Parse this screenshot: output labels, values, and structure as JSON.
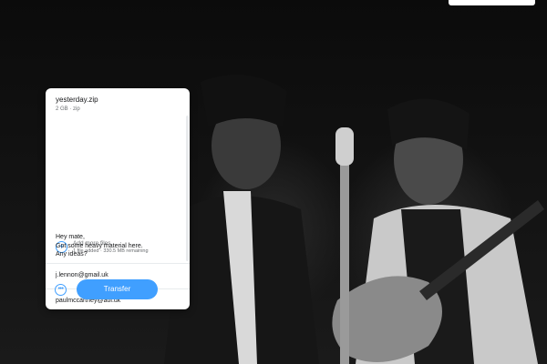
{
  "file": {
    "name": "yesterday.zip",
    "meta": "2 GB · zip"
  },
  "add_files": {
    "label": "Add more files",
    "status": "1 file added · 330.5 MB remaining",
    "icon": "plus-circle-icon"
  },
  "fields": {
    "email_to": "j.lennon@gmail.uk",
    "email_from": "paulmccartney@aol.uk",
    "message": [
      "Hey mate,",
      "Got some heavy material here.",
      "Any ideas?"
    ]
  },
  "actions": {
    "more_icon": "ellipsis-icon",
    "transfer_label": "Transfer"
  },
  "colors": {
    "accent": "#409fff",
    "panel_bg": "#ffffff",
    "text": "#17181a",
    "muted": "#6a6d70",
    "page_bg": "#0f0f0f"
  }
}
